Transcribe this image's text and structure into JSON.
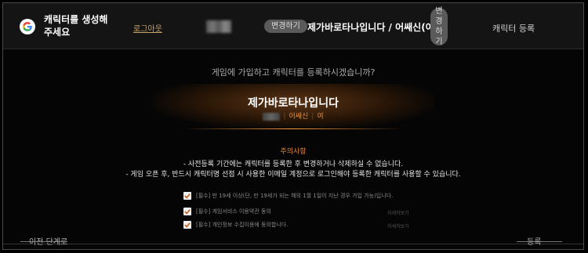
{
  "header": {
    "prompt": "캐릭터를 생성해주세요",
    "logout_label": "로그아웃",
    "change_label": "변경하기",
    "character_info": "제가바로타나입니다 / 어쌔신(여)",
    "change_vertical": [
      "변",
      "경",
      "하",
      "기"
    ],
    "register_label": "캐릭터 등록"
  },
  "main": {
    "question": "게임에 가입하고 캐릭터를 등록하시겠습니까?",
    "character_name": "제가바로타나입니다",
    "character_class": "어쌔신",
    "character_gender": "여",
    "notice_title": "주의사항",
    "notices": [
      "- 사전등록 기간에는 캐릭터를 등록한 후 변경하거나 삭제하실 수 없습니다.",
      "- 게임 오픈 후, 반드시 캐릭터명 선점 시 사용한 이메일 계정으로 로그인해야 등록한 캐릭터를 사용할 수 있습니다."
    ],
    "agreements": [
      {
        "text": "[필수] 만 19세 이상(단, 만 19세가 되는 해의 1월 1일이 지난 경우 가입 가능)입니다.",
        "detail": ""
      },
      {
        "text": "[필수] 게임서비스 이용약관 동의",
        "detail": "자세히보기"
      },
      {
        "text": "[필수] 개인정보 수집이용에 동의합니다.",
        "detail": "자세히보기"
      }
    ]
  },
  "footer": {
    "prev_label": "이전 단계로",
    "next_label": "등록"
  },
  "colors": {
    "accent": "#e08a3a",
    "background": "#000000"
  }
}
